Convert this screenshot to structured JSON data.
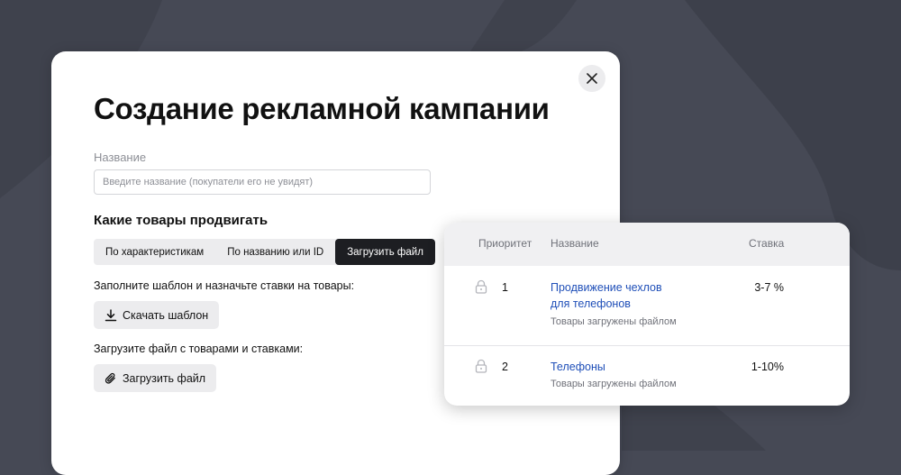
{
  "modal": {
    "title": "Создание рекламной кампании",
    "name_field": {
      "label": "Название",
      "value": "",
      "placeholder": "Введите название (покупатели его не увидят)"
    },
    "products_section": {
      "title": "Какие товары продвигать",
      "tabs": [
        {
          "label": "По характеристикам",
          "active": false
        },
        {
          "label": "По названию или ID",
          "active": false
        },
        {
          "label": "Загрузить файл",
          "active": true
        }
      ]
    },
    "template_hint": "Заполните шаблон и назначьте ставки на товары:",
    "download_button": {
      "label": "Скачать шаблон",
      "icon": "download-icon"
    },
    "upload_hint": "Загрузите файл с товарами и ставками:",
    "upload_button": {
      "label": "Загрузить файл",
      "icon": "paperclip-icon"
    },
    "close_icon": "close-icon"
  },
  "table": {
    "columns": [
      "Приоритет",
      "Название",
      "Ставка"
    ],
    "rows": [
      {
        "priority": "1",
        "name_line1": "Продвижение чехлов",
        "name_line2": "для телефонов",
        "subtitle": "Товары загружены файлом",
        "rate": "3-7 %",
        "icon": "lock-icon"
      },
      {
        "priority": "2",
        "name_line1": "Телефоны",
        "subtitle": "Товары загружены файлом",
        "rate": "1-10%",
        "icon": "lock-icon"
      }
    ]
  },
  "colors": {
    "background": "#464955",
    "accent_dark": "#1d1e22",
    "link": "#1f4fb8",
    "muted_text": "#8d8f96",
    "button_gray": "#ececee"
  }
}
